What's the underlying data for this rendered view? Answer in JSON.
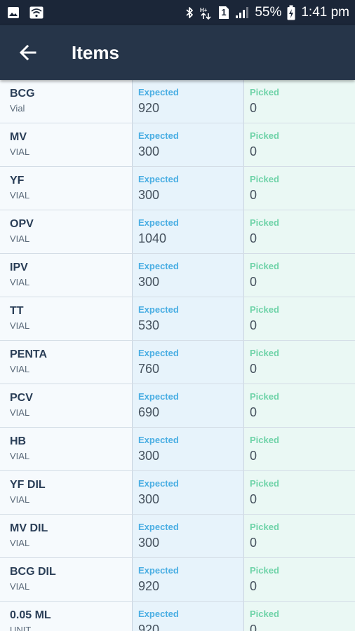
{
  "status_bar": {
    "battery": "55%",
    "time": "1:41 pm",
    "sim_badge": "1",
    "left_icons": [
      "image-icon",
      "wifi-icon"
    ],
    "right_icons": [
      "bluetooth-icon",
      "network-data-icon",
      "sim-icon",
      "signal-icon",
      "battery-charging-icon"
    ]
  },
  "header": {
    "title": "Items",
    "back_icon": "arrow-left-icon"
  },
  "labels": {
    "expected": "Expected",
    "picked": "Picked"
  },
  "items": [
    {
      "name": "BCG",
      "unit": "Vial",
      "expected": "920",
      "picked": "0"
    },
    {
      "name": "MV",
      "unit": "VIAL",
      "expected": "300",
      "picked": "0"
    },
    {
      "name": "YF",
      "unit": "VIAL",
      "expected": "300",
      "picked": "0"
    },
    {
      "name": "OPV",
      "unit": "VIAL",
      "expected": "1040",
      "picked": "0"
    },
    {
      "name": "IPV",
      "unit": "VIAL",
      "expected": "300",
      "picked": "0"
    },
    {
      "name": "TT",
      "unit": "VIAL",
      "expected": "530",
      "picked": "0"
    },
    {
      "name": "PENTA",
      "unit": "VIAL",
      "expected": "760",
      "picked": "0"
    },
    {
      "name": "PCV",
      "unit": "VIAL",
      "expected": "690",
      "picked": "0"
    },
    {
      "name": "HB",
      "unit": "VIAL",
      "expected": "300",
      "picked": "0"
    },
    {
      "name": "YF DIL",
      "unit": "VIAL",
      "expected": "300",
      "picked": "0"
    },
    {
      "name": "MV DIL",
      "unit": "VIAL",
      "expected": "300",
      "picked": "0"
    },
    {
      "name": "BCG DIL",
      "unit": "VIAL",
      "expected": "920",
      "picked": "0"
    },
    {
      "name": "0.05 ML",
      "unit": "UNIT",
      "expected": "920",
      "picked": "0"
    }
  ]
}
